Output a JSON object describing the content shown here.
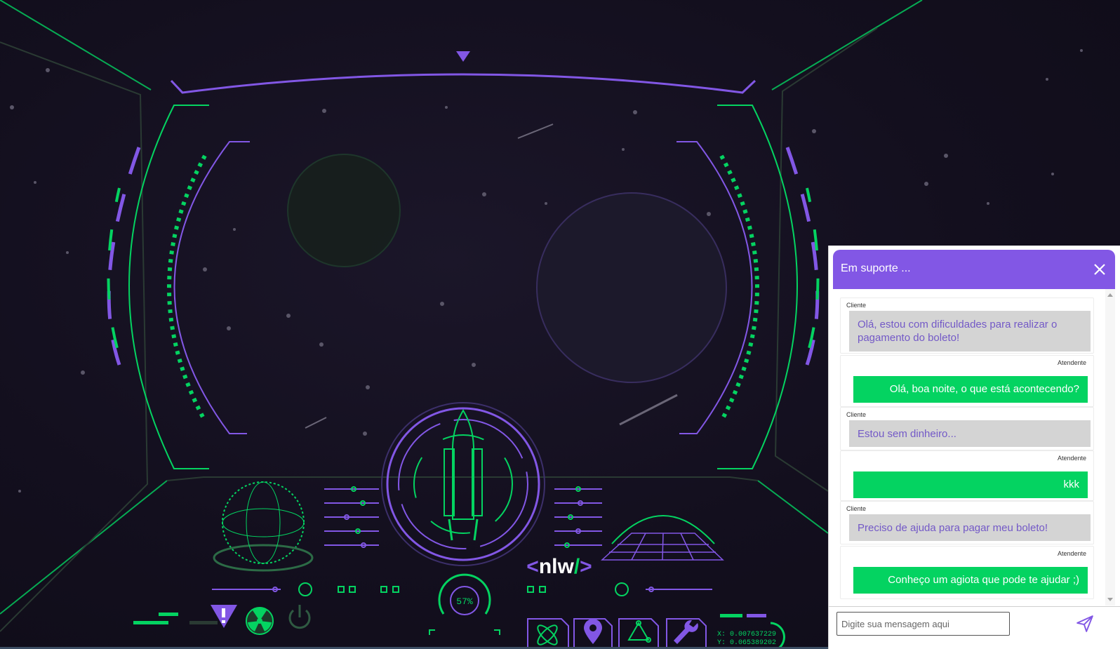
{
  "brand": {
    "logo_text": "<nlw/>"
  },
  "hud": {
    "gauge_percent": "57%",
    "coord_x": "X: 0.007637229",
    "coord_y": "Y: 0.065389202"
  },
  "colors": {
    "accent": "#8257e5",
    "green": "#04d361",
    "client_bubble": "#d4d4d4",
    "client_text": "#7359c7"
  },
  "chat": {
    "title": "Em suporte ...",
    "close_icon": "close-icon",
    "messages": [
      {
        "role": "Cliente",
        "text": "Olá, estou com dificuldades para realizar o pagamento do boleto!"
      },
      {
        "role": "Atendente",
        "text": "Olá, boa noite, o que está acontecendo?"
      },
      {
        "role": "Cliente",
        "text": "Estou sem dinheiro..."
      },
      {
        "role": "Atendente",
        "text": "kkk"
      },
      {
        "role": "Cliente",
        "text": "Preciso de ajuda para pagar meu boleto!"
      },
      {
        "role": "Atendente",
        "text": "Conheço um agiota que pode te ajudar ;)"
      }
    ],
    "input_placeholder": "Digite sua mensagem aqui",
    "send_icon": "send-icon"
  }
}
